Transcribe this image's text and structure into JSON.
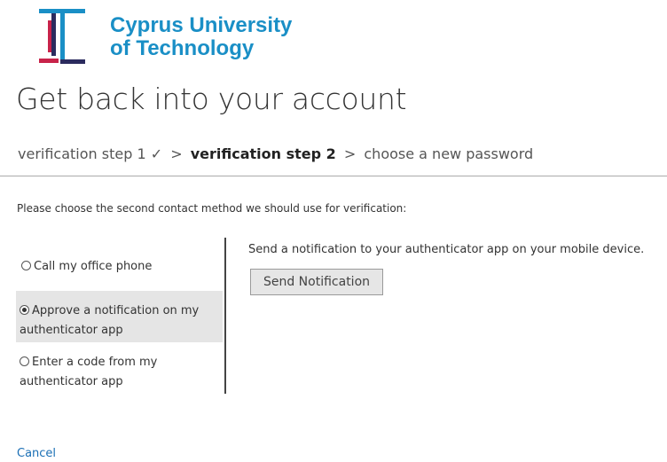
{
  "brand": {
    "name_line1": "Cyprus University",
    "name_line2": "of Technology",
    "color": "#1a8fc6",
    "logo_icon": "cut-logo-icon"
  },
  "page": {
    "title": "Get back into your account",
    "instruction": "Please choose the second contact method we should use for verification:"
  },
  "breadcrumb": {
    "step1": "verification step 1 ✓",
    "separator": ">",
    "step2": "verification step 2",
    "step3": "choose a new password"
  },
  "methods": [
    {
      "label": "Call my office phone",
      "selected": false
    },
    {
      "label": "Approve a notification on my authenticator app",
      "selected": true
    },
    {
      "label": "Enter a code from my authenticator app",
      "selected": false
    }
  ],
  "detail": {
    "text": "Send a notification to your authenticator app on your mobile device.",
    "button_label": "Send Notification"
  },
  "footer": {
    "cancel_label": "Cancel"
  }
}
